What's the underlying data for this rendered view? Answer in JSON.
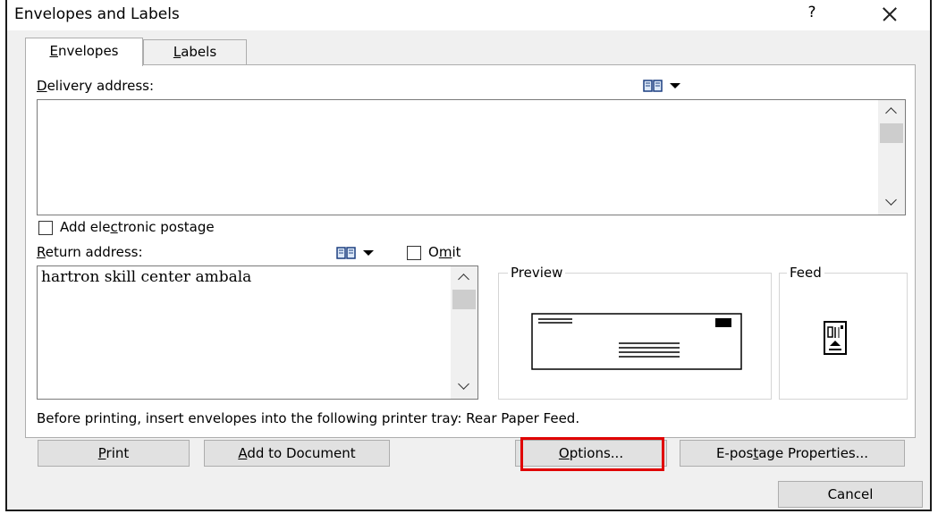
{
  "window": {
    "title": "Envelopes and Labels",
    "help": "?"
  },
  "tabs": [
    {
      "pre": "",
      "key": "E",
      "post": "nvelopes"
    },
    {
      "pre": "",
      "key": "L",
      "post": "abels"
    }
  ],
  "delivery": {
    "pre": "",
    "key": "D",
    "post": "elivery address:",
    "value": ""
  },
  "postage": {
    "pre": "Add ele",
    "key": "c",
    "post": "tronic postage",
    "checked": false
  },
  "return": {
    "pre": "",
    "key": "R",
    "post": "eturn address:",
    "value": "hartron skill center ambala"
  },
  "omit": {
    "pre": "O",
    "key": "m",
    "post": "it",
    "checked": false
  },
  "preview": {
    "title": "Preview"
  },
  "feed": {
    "title": "Feed"
  },
  "status_text": "Before printing, insert envelopes into the following printer tray: Rear Paper Feed.",
  "buttons": {
    "print": {
      "pre": "",
      "key": "P",
      "post": "rint"
    },
    "add_to_document": {
      "pre": "",
      "key": "A",
      "post": "dd to Document"
    },
    "options": {
      "pre": "",
      "key": "O",
      "post": "ptions..."
    },
    "epostage": {
      "pre": "E-pos",
      "key": "t",
      "post": "age Properties..."
    },
    "cancel": "Cancel"
  },
  "colors": {
    "highlight": "#e00000",
    "dialog_bg": "#f0f0f0",
    "button_bg": "#e1e1e1"
  },
  "icons": [
    "address-book-icon",
    "dropdown-arrow-icon",
    "close-icon",
    "envelope-preview-icon",
    "feed-icon"
  ]
}
